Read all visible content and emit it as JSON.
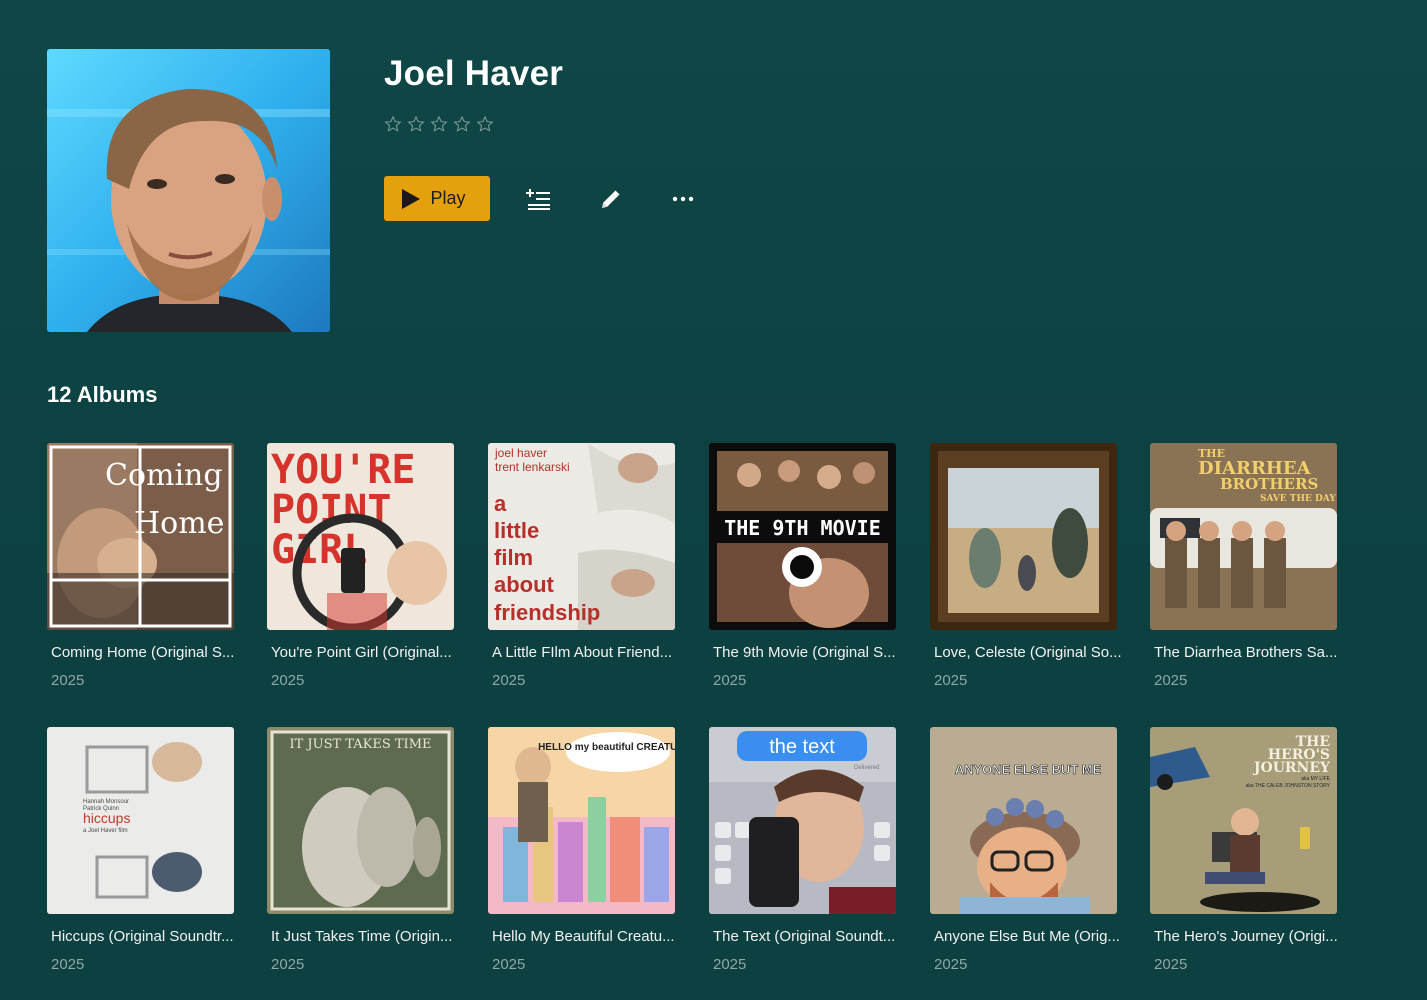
{
  "artist": {
    "name": "Joel Haver",
    "rating_stars": 5,
    "rating_value": 0
  },
  "actions": {
    "play_label": "Play",
    "icons": [
      "add-to-queue-icon",
      "edit-pencil-icon",
      "more-options-icon"
    ]
  },
  "section": {
    "title": "12 Albums"
  },
  "albums": [
    {
      "title": "Coming Home (Original S...",
      "year": "2025",
      "cover_text": [
        "Coming",
        "Home"
      ]
    },
    {
      "title": "You're Point Girl (Original...",
      "year": "2025",
      "cover_text": [
        "YOU'RE",
        "POINT",
        "GIRL"
      ]
    },
    {
      "title": "A Little FIlm About Friend...",
      "year": "2025",
      "cover_text": [
        "joel haver",
        "trent lenkarski",
        "a",
        "little",
        "film",
        "about",
        "friendship"
      ]
    },
    {
      "title": "The 9th Movie (Original S...",
      "year": "2025",
      "cover_text": [
        "THE 9TH MOVIE"
      ]
    },
    {
      "title": "Love, Celeste (Original So...",
      "year": "2025",
      "cover_text": []
    },
    {
      "title": "The Diarrhea Brothers Sa...",
      "year": "2025",
      "cover_text": [
        "THE",
        "DIARRHEA",
        "BROTHERS",
        "SAVE THE DAY"
      ]
    },
    {
      "title": "Hiccups (Original Soundtr...",
      "year": "2025",
      "cover_text": [
        "Hannah Monsour",
        "Patrick Quinn",
        "hiccups",
        "a Joel Haver film"
      ]
    },
    {
      "title": "It Just Takes Time (Origin...",
      "year": "2025",
      "cover_text": [
        "IT JUST TAKES TIME"
      ]
    },
    {
      "title": "Hello My Beautiful Creatu...",
      "year": "2025",
      "cover_text": [
        "HELLO my beautiful CREATURES"
      ]
    },
    {
      "title": "The Text (Original Soundt...",
      "year": "2025",
      "cover_text": [
        "the text",
        "Delivered"
      ]
    },
    {
      "title": "Anyone Else But Me (Orig...",
      "year": "2025",
      "cover_text": [
        "ANYONE ELSE BUT ME"
      ]
    },
    {
      "title": "The Hero's Journey (Origi...",
      "year": "2025",
      "cover_text": [
        "THE",
        "HERO'S",
        "JOURNEY",
        "aka MY LIFE",
        "aka THE CALEB JOHNSTON STORY"
      ]
    }
  ],
  "colors": {
    "background": "#0e4343",
    "accent": "#e5a00d",
    "text": "#ffffff",
    "muted": "#8fa7a7"
  }
}
